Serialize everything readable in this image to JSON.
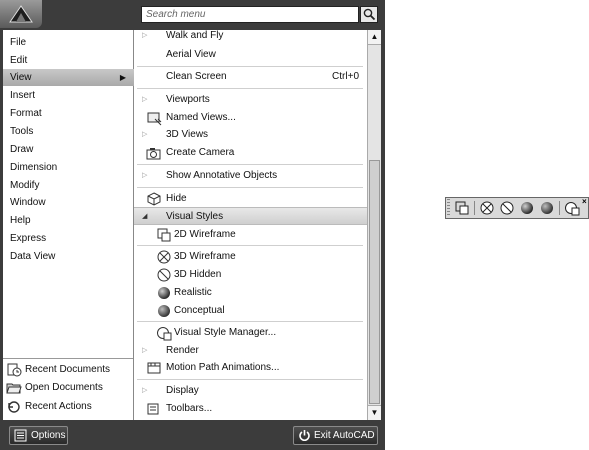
{
  "search": {
    "placeholder": "Search menu"
  },
  "left_menu": {
    "items": [
      {
        "label": "File"
      },
      {
        "label": "Edit"
      },
      {
        "label": "View",
        "arrow": "▶"
      },
      {
        "label": "Insert"
      },
      {
        "label": "Format"
      },
      {
        "label": "Tools"
      },
      {
        "label": "Draw"
      },
      {
        "label": "Dimension"
      },
      {
        "label": "Modify"
      },
      {
        "label": "Window"
      },
      {
        "label": "Help"
      },
      {
        "label": "Express"
      },
      {
        "label": "Data View"
      }
    ],
    "selected_index": 2
  },
  "recent": {
    "documents": "Recent Documents",
    "open_documents": "Open Documents",
    "actions": "Recent Actions"
  },
  "view_submenu": {
    "walk_and_fly": "Walk and Fly",
    "aerial_view": "Aerial View",
    "clean_screen": "Clean Screen",
    "clean_screen_shortcut": "Ctrl+0",
    "viewports": "Viewports",
    "named_views": "Named Views...",
    "views_3d": "3D Views",
    "create_camera": "Create Camera",
    "show_annotative": "Show Annotative Objects",
    "hide": "Hide",
    "visual_styles": "Visual Styles",
    "wireframe_2d": "2D Wireframe",
    "wireframe_3d": "3D Wireframe",
    "hidden_3d": "3D Hidden",
    "realistic": "Realistic",
    "conceptual": "Conceptual",
    "vs_manager": "Visual Style Manager...",
    "render": "Render",
    "motion_path": "Motion Path Animations...",
    "display": "Display",
    "toolbars": "Toolbars..."
  },
  "bottom": {
    "options": "Options",
    "exit": "Exit AutoCAD"
  },
  "toolbar": {
    "close_glyph": "×",
    "buttons": [
      "2d-wireframe-icon",
      "3d-wireframe-icon",
      "3d-hidden-icon",
      "realistic-icon",
      "conceptual-icon",
      "visual-style-manager-icon"
    ]
  },
  "colors": {
    "frame": "#3c3c3c",
    "selected_item": "#b5b5b5",
    "pane": "#ffffff"
  }
}
